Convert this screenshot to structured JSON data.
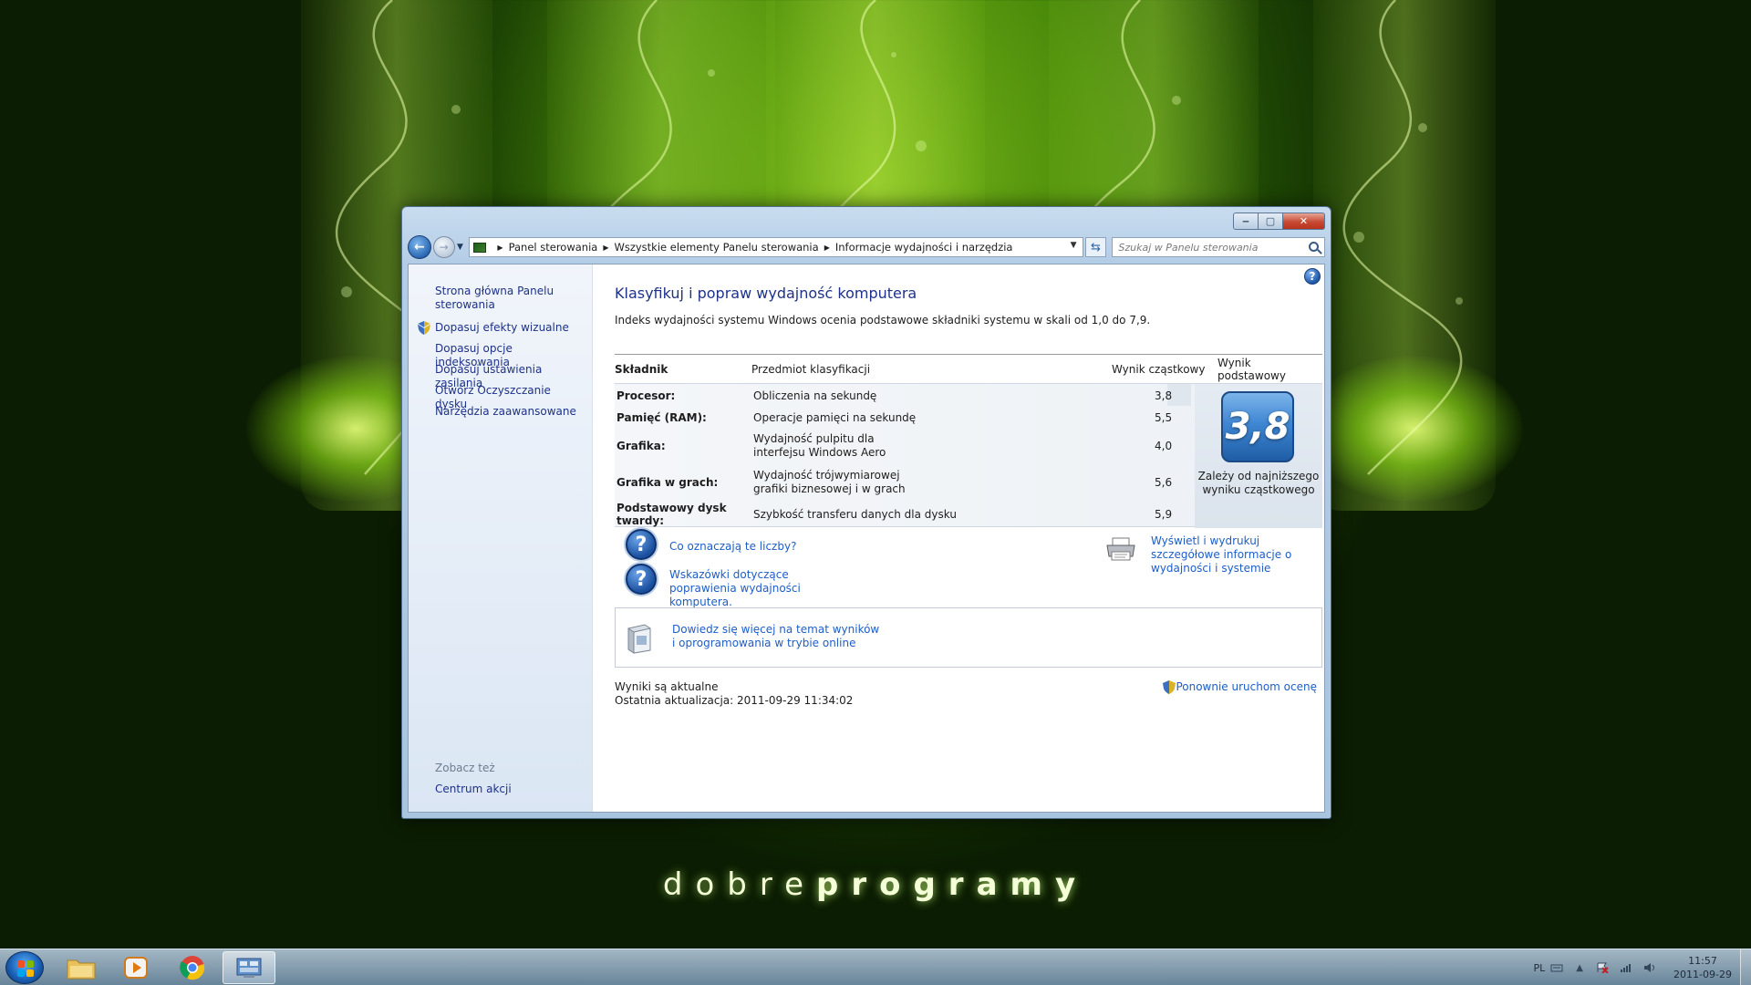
{
  "wallpaper": {
    "brand_light": "dobre",
    "brand_bold": "programy"
  },
  "window": {
    "controls": {
      "minimize": "‒",
      "maximize": "▢",
      "close": "✕"
    },
    "breadcrumb": [
      "Panel sterowania",
      "Wszystkie elementy Panelu sterowania",
      "Informacje wydajności i narzędzia"
    ],
    "search_placeholder": "Szukaj w Panelu sterowania",
    "sidebar": {
      "home_link": "Strona główna Panelu sterowania",
      "tasks": [
        "Dopasuj efekty wizualne",
        "Dopasuj opcje indeksowania",
        "Dopasuj ustawienia zasilania",
        "Otwórz Oczyszczanie dysku",
        "Narzędzia zaawansowane"
      ],
      "see_also_label": "Zobacz też",
      "see_also_links": [
        "Centrum akcji"
      ]
    },
    "main": {
      "help": "?",
      "title": "Klasyfikuj i popraw wydajność komputera",
      "intro": "Indeks wydajności systemu Windows ocenia podstawowe składniki systemu w skali od 1,0 do 7,9.",
      "table": {
        "headers": [
          "Składnik",
          "Przedmiot klasyfikacji",
          "Wynik cząstkowy",
          "Wynik podstawowy"
        ],
        "rows": [
          {
            "component": "Procesor:",
            "subject": "Obliczenia na sekundę",
            "score": "3,8"
          },
          {
            "component": "Pamięć (RAM):",
            "subject": "Operacje pamięci na sekundę",
            "score": "5,5"
          },
          {
            "component": "Grafika:",
            "subject": "Wydajność pulpitu dla interfejsu Windows Aero",
            "score": "4,0"
          },
          {
            "component": "Grafika w grach:",
            "subject": "Wydajność trójwymiarowej grafiki biznesowej i w grach",
            "score": "5,6"
          },
          {
            "component": "Podstawowy dysk twardy:",
            "subject": "Szybkość transferu danych dla dysku",
            "score": "5,9"
          }
        ],
        "base_score": "3,8",
        "base_note": "Zależy od najniższego wyniku cząstkowego"
      },
      "links": {
        "what_numbers": "Co oznaczają te liczby?",
        "tips": "Wskazówki dotyczące poprawienia wydajności komputera.",
        "print_details": "Wyświetl i wydrukuj szczegółowe informacje o wydajności i systemie",
        "learn_more": "Dowiedz się więcej na temat wyników i oprogramowania w trybie online",
        "rerun": "Ponownie uruchom ocenę"
      },
      "status": {
        "current": "Wyniki są aktualne",
        "last_update": "Ostatnia aktualizacja: 2011-09-29 11:34:02"
      }
    }
  },
  "taskbar": {
    "language": "PL",
    "time": "11:57",
    "date": "2011-09-29"
  }
}
